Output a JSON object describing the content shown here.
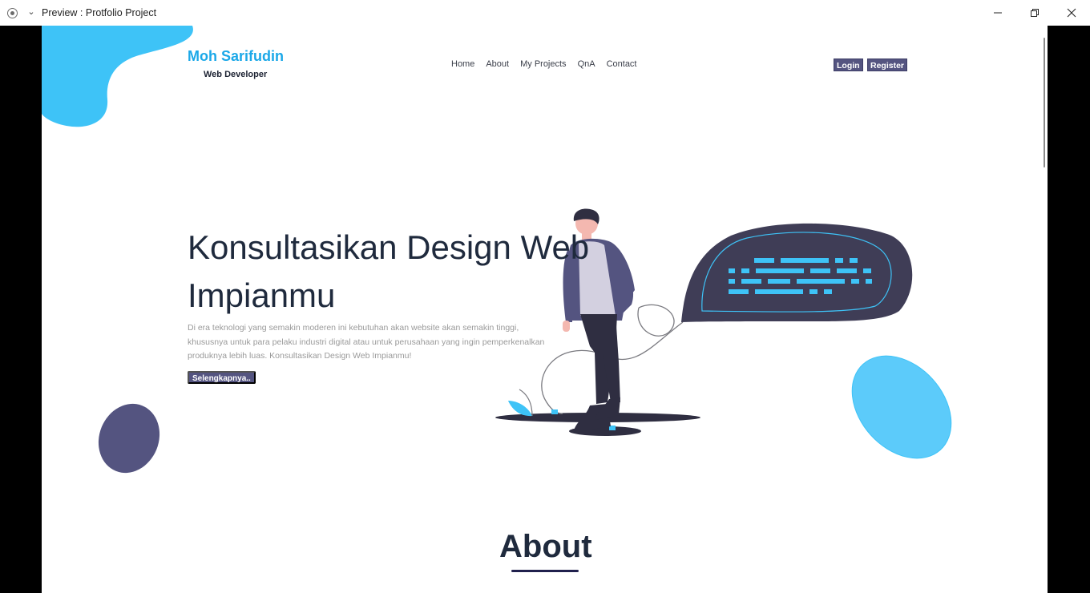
{
  "window": {
    "title": "Preview : Protfolio Project",
    "icons": [
      "record-icon",
      "chevron-down-icon",
      "minimize-icon",
      "restore-icon",
      "close-icon"
    ]
  },
  "brand": {
    "name": "Moh Sarifudin",
    "role": "Web Developer"
  },
  "nav": {
    "items": [
      "Home",
      "About",
      "My Projects",
      "QnA",
      "Contact"
    ]
  },
  "auth": {
    "login_label": "Login",
    "register_label": "Register"
  },
  "hero": {
    "title_line1": "Konsultasikan Design Web",
    "title_line2": "Impianmu",
    "description": "Di era teknologi yang semakin moderen ini kebutuhan akan website akan semakin tinggi, khususnya untuk para pelaku industri digital atau untuk perusahaan yang ingin pemperkenalkan produknya lebih luas. Konsultasikan Design Web Impianmu!",
    "cta_label": "Selengkapnya.."
  },
  "about": {
    "title": "About"
  },
  "colors": {
    "accent_blue": "#3ec3f7",
    "accent_purple": "#545480",
    "text_dark": "#1f2a3d",
    "brand_blue": "#1ba8e8"
  }
}
